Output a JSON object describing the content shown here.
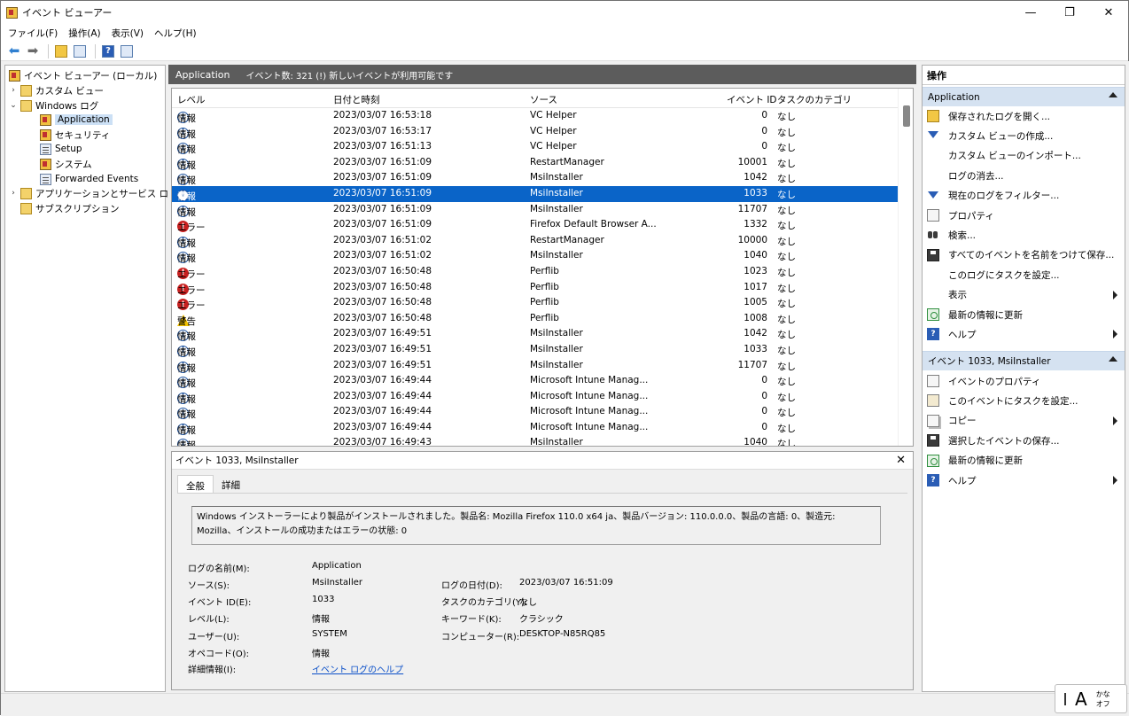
{
  "window": {
    "title": "イベント ビューアー",
    "minimize": "—",
    "maximize": "❐",
    "close": "✕"
  },
  "menu": [
    "ファイル(F)",
    "操作(A)",
    "表示(V)",
    "ヘルプ(H)"
  ],
  "tree": {
    "root": "イベント ビューアー (ローカル)",
    "items": [
      {
        "label": "カスタム ビュー",
        "expander": "›"
      },
      {
        "label": "Windows ログ",
        "expander": "⌄"
      },
      {
        "label": "Application"
      },
      {
        "label": "セキュリティ"
      },
      {
        "label": "Setup"
      },
      {
        "label": "システム"
      },
      {
        "label": "Forwarded Events"
      },
      {
        "label": "アプリケーションとサービス ログ",
        "expander": "›"
      },
      {
        "label": "サブスクリプション"
      }
    ]
  },
  "log_header": {
    "title": "Application",
    "summary": "イベント数: 321 (!) 新しいイベントが利用可能です"
  },
  "grid": {
    "columns": [
      "レベル",
      "日付と時刻",
      "ソース",
      "イベント ID",
      "タスクのカテゴリ"
    ],
    "rows": [
      {
        "level": "情報",
        "type": "info",
        "date": "2023/03/07 16:53:18",
        "source": "VC Helper",
        "id": "0",
        "category": "なし"
      },
      {
        "level": "情報",
        "type": "info",
        "date": "2023/03/07 16:53:17",
        "source": "VC Helper",
        "id": "0",
        "category": "なし"
      },
      {
        "level": "情報",
        "type": "info",
        "date": "2023/03/07 16:51:13",
        "source": "VC Helper",
        "id": "0",
        "category": "なし"
      },
      {
        "level": "情報",
        "type": "info",
        "date": "2023/03/07 16:51:09",
        "source": "RestartManager",
        "id": "10001",
        "category": "なし"
      },
      {
        "level": "情報",
        "type": "info",
        "date": "2023/03/07 16:51:09",
        "source": "MsiInstaller",
        "id": "1042",
        "category": "なし"
      },
      {
        "level": "情報",
        "type": "info",
        "date": "2023/03/07 16:51:09",
        "source": "MsiInstaller",
        "id": "1033",
        "category": "なし",
        "selected": true
      },
      {
        "level": "情報",
        "type": "info",
        "date": "2023/03/07 16:51:09",
        "source": "MsiInstaller",
        "id": "11707",
        "category": "なし"
      },
      {
        "level": "エラー",
        "type": "err",
        "date": "2023/03/07 16:51:09",
        "source": "Firefox Default Browser A...",
        "id": "1332",
        "category": "なし"
      },
      {
        "level": "情報",
        "type": "info",
        "date": "2023/03/07 16:51:02",
        "source": "RestartManager",
        "id": "10000",
        "category": "なし"
      },
      {
        "level": "情報",
        "type": "info",
        "date": "2023/03/07 16:51:02",
        "source": "MsiInstaller",
        "id": "1040",
        "category": "なし"
      },
      {
        "level": "エラー",
        "type": "err",
        "date": "2023/03/07 16:50:48",
        "source": "Perflib",
        "id": "1023",
        "category": "なし"
      },
      {
        "level": "エラー",
        "type": "err",
        "date": "2023/03/07 16:50:48",
        "source": "Perflib",
        "id": "1017",
        "category": "なし"
      },
      {
        "level": "エラー",
        "type": "err",
        "date": "2023/03/07 16:50:48",
        "source": "Perflib",
        "id": "1005",
        "category": "なし"
      },
      {
        "level": "警告",
        "type": "warn",
        "date": "2023/03/07 16:50:48",
        "source": "Perflib",
        "id": "1008",
        "category": "なし"
      },
      {
        "level": "情報",
        "type": "info",
        "date": "2023/03/07 16:49:51",
        "source": "MsiInstaller",
        "id": "1042",
        "category": "なし"
      },
      {
        "level": "情報",
        "type": "info",
        "date": "2023/03/07 16:49:51",
        "source": "MsiInstaller",
        "id": "1033",
        "category": "なし"
      },
      {
        "level": "情報",
        "type": "info",
        "date": "2023/03/07 16:49:51",
        "source": "MsiInstaller",
        "id": "11707",
        "category": "なし"
      },
      {
        "level": "情報",
        "type": "info",
        "date": "2023/03/07 16:49:44",
        "source": "Microsoft Intune Manag...",
        "id": "0",
        "category": "なし"
      },
      {
        "level": "情報",
        "type": "info",
        "date": "2023/03/07 16:49:44",
        "source": "Microsoft Intune Manag...",
        "id": "0",
        "category": "なし"
      },
      {
        "level": "情報",
        "type": "info",
        "date": "2023/03/07 16:49:44",
        "source": "Microsoft Intune Manag...",
        "id": "0",
        "category": "なし"
      },
      {
        "level": "情報",
        "type": "info",
        "date": "2023/03/07 16:49:44",
        "source": "Microsoft Intune Manag...",
        "id": "0",
        "category": "なし"
      },
      {
        "level": "情報",
        "type": "info",
        "date": "2023/03/07 16:49:43",
        "source": "MsiInstaller",
        "id": "1040",
        "category": "なし"
      }
    ]
  },
  "detail": {
    "title": "イベント 1033, MsiInstaller",
    "tabs": [
      "全般",
      "詳細"
    ],
    "message": "Windows インストーラーにより製品がインストールされました。製品名: Mozilla Firefox 110.0 x64 ja、製品バージョン: 110.0.0.0、製品の言語: 0、製造元: Mozilla、インストールの成功またはエラーの状態: 0",
    "labels": {
      "log_name": "ログの名前(M):",
      "source": "ソース(S):",
      "event_id": "イベント ID(E):",
      "level": "レベル(L):",
      "user": "ユーザー(U):",
      "opcode": "オペコード(O):",
      "more_info": "詳細情報(I):",
      "logged": "ログの日付(D):",
      "task_category": "タスクのカテゴリ(Y):",
      "keywords": "キーワード(K):",
      "computer": "コンピューター(R):"
    },
    "values": {
      "log_name": "Application",
      "source": "MsiInstaller",
      "event_id": "1033",
      "level": "情報",
      "user": "SYSTEM",
      "opcode": "情報",
      "more_info": "イベント ログのヘルプ",
      "logged": "2023/03/07 16:51:09",
      "task_category": "なし",
      "keywords": "クラシック",
      "computer": "DESKTOP-N85RQ85"
    }
  },
  "actions": {
    "title": "操作",
    "section1": "Application",
    "items1": [
      {
        "label": "保存されたログを開く...",
        "icon": "open"
      },
      {
        "label": "カスタム ビューの作成...",
        "icon": "filter"
      },
      {
        "label": "カスタム ビューのインポート...",
        "icon": "none"
      },
      {
        "label": "ログの消去...",
        "icon": "none"
      },
      {
        "label": "現在のログをフィルター...",
        "icon": "filter"
      },
      {
        "label": "プロパティ",
        "icon": "prop"
      },
      {
        "label": "検索...",
        "icon": "find"
      },
      {
        "label": "すべてのイベントを名前をつけて保存...",
        "icon": "save"
      },
      {
        "label": "このログにタスクを設定...",
        "icon": "none"
      },
      {
        "label": "表示",
        "icon": "none",
        "sub": true
      },
      {
        "label": "最新の情報に更新",
        "icon": "refresh"
      },
      {
        "label": "ヘルプ",
        "icon": "help",
        "sub": true
      }
    ],
    "section2": "イベント 1033, MsiInstaller",
    "items2": [
      {
        "label": "イベントのプロパティ",
        "icon": "prop"
      },
      {
        "label": "このイベントにタスクを設定...",
        "icon": "task"
      },
      {
        "label": "コピー",
        "icon": "copy",
        "sub": true
      },
      {
        "label": "選択したイベントの保存...",
        "icon": "save"
      },
      {
        "label": "最新の情報に更新",
        "icon": "refresh"
      },
      {
        "label": "ヘルプ",
        "icon": "help",
        "sub": true
      }
    ]
  },
  "ime": {
    "mode": "A",
    "kana": "かな",
    "off": "オフ"
  }
}
